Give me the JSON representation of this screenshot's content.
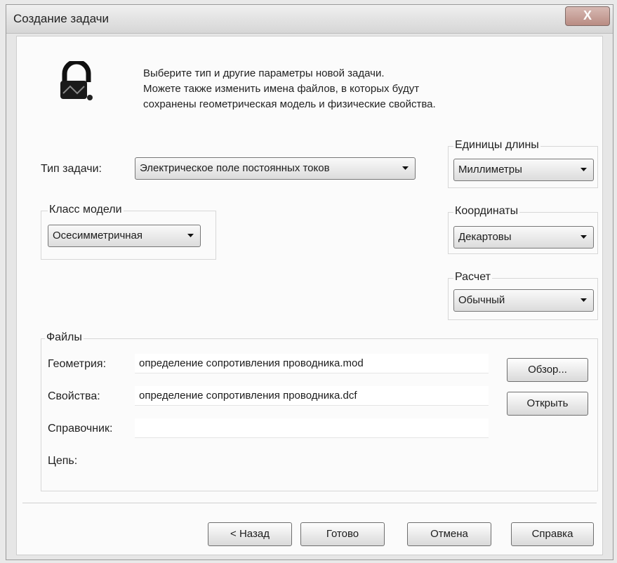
{
  "window": {
    "title": "Создание задачи",
    "close_label": "X"
  },
  "header": {
    "lines": [
      "Выберите тип и другие параметры новой задачи.",
      "Можете также изменить имена файлов, в которых будут",
      "сохранены геометрическая модель и физические свойства."
    ],
    "icon": "padlock-icon"
  },
  "task_type": {
    "label": "Тип задачи:",
    "value": "Электрическое поле постоянных токов"
  },
  "model_class": {
    "label": "Класс модели",
    "value": "Осесимметричная"
  },
  "length_units": {
    "label": "Единицы длины",
    "value": "Миллиметры"
  },
  "coordinates": {
    "label": "Координаты",
    "value": "Декартовы"
  },
  "calculation": {
    "label": "Расчет",
    "value": "Обычный"
  },
  "files": {
    "label": "Файлы",
    "geometry": {
      "label": "Геометрия:",
      "value": "определение сопротивления проводника.mod"
    },
    "properties": {
      "label": "Свойства:",
      "value": "определение сопротивления проводника.dcf"
    },
    "reference": {
      "label": "Справочник:",
      "value": ""
    },
    "circuit": {
      "label": "Цепь:"
    },
    "browse_label": "Обзор...",
    "open_label": "Открыть"
  },
  "buttons": {
    "back": "< Назад",
    "finish": "Готово",
    "cancel": "Отмена",
    "help": "Справка"
  }
}
